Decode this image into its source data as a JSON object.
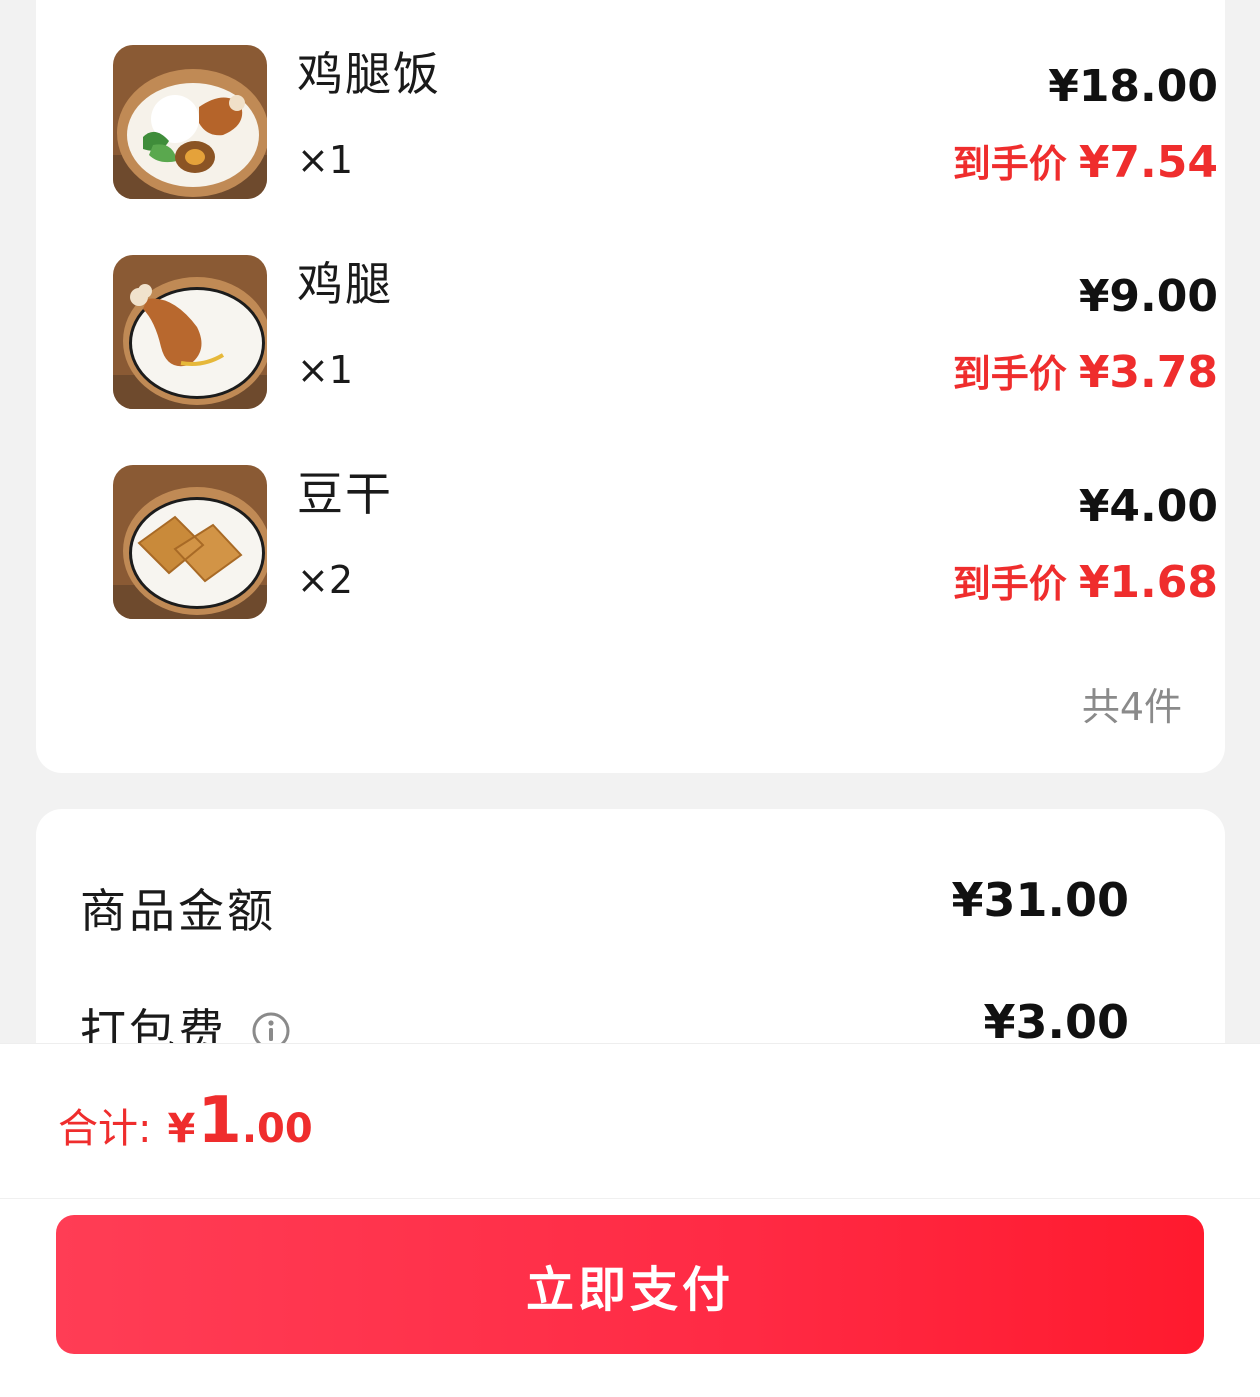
{
  "items": [
    {
      "name": "鸡腿饭",
      "qty": "×1",
      "price": "¥18.00",
      "net_label": "到手价",
      "net_price": "¥7.54",
      "image_icon": "chicken-leg-rice-image"
    },
    {
      "name": "鸡腿",
      "qty": "×1",
      "price": "¥9.00",
      "net_label": "到手价",
      "net_price": "¥3.78",
      "image_icon": "chicken-leg-image"
    },
    {
      "name": "豆干",
      "qty": "×2",
      "price": "¥4.00",
      "net_label": "到手价",
      "net_price": "¥1.68",
      "image_icon": "dried-tofu-image"
    }
  ],
  "items_count": "共4件",
  "summary": {
    "goods_label": "商品金额",
    "goods_value": "¥31.00",
    "packing_label": "打包费",
    "packing_value": "¥3.00",
    "packing_icon": "info-icon"
  },
  "footer": {
    "total_label": "合计:",
    "total_currency": "¥",
    "total_int": "1",
    "total_dec": ".00",
    "pay_button": "立即支付"
  },
  "colors": {
    "accent": "#ef2d2d",
    "button_start": "#ff3d55",
    "button_end": "#ff1a2e",
    "background": "#f2f2f2"
  }
}
